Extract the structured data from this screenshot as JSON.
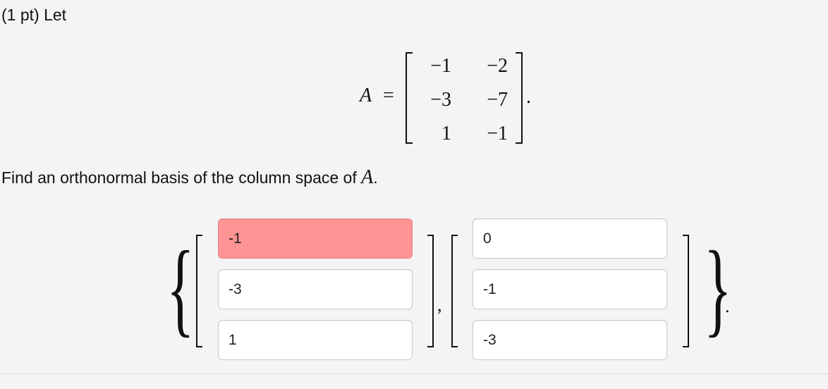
{
  "problem": {
    "points_label": "(1 pt) Let",
    "matrix": {
      "name": "A",
      "equals": "=",
      "rows": [
        [
          "−1",
          "−2"
        ],
        [
          "−3",
          "−7"
        ],
        [
          "1",
          "−1"
        ]
      ],
      "trailing": "."
    },
    "question": {
      "text": "Find an orthonormal basis of the column space of ",
      "variable": "A",
      "end": "."
    }
  },
  "answer": {
    "open_brace": "{",
    "close_brace": "}",
    "separator": ",",
    "end": ".",
    "vectors": [
      {
        "fields": [
          {
            "value": "-1",
            "status": "incorrect"
          },
          {
            "value": "-3",
            "status": "neutral"
          },
          {
            "value": "1",
            "status": "neutral"
          }
        ]
      },
      {
        "fields": [
          {
            "value": "0",
            "status": "neutral"
          },
          {
            "value": "-1",
            "status": "neutral"
          },
          {
            "value": "-3",
            "status": "neutral"
          }
        ]
      }
    ],
    "status_colors": {
      "incorrect": "#ff9494",
      "neutral": "#ffffff"
    }
  }
}
